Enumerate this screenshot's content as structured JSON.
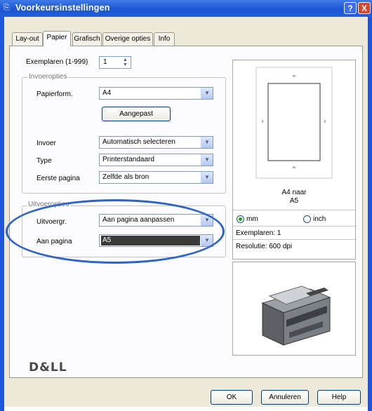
{
  "window": {
    "title": "Voorkeursinstellingen",
    "help_button": "?",
    "close_button": "X"
  },
  "tabs": [
    {
      "label": "Lay-out"
    },
    {
      "label": "Papier"
    },
    {
      "label": "Grafisch"
    },
    {
      "label": "Overige opties"
    },
    {
      "label": "Info"
    }
  ],
  "copies": {
    "label": "Exemplaren (1-999)",
    "value": "1"
  },
  "input_options": {
    "title": "Invoeropties",
    "paper_size_label": "Papierform.",
    "paper_size_value": "A4",
    "custom_button": "Aangepast",
    "source_label": "Invoer",
    "source_value": "Automatisch selecteren",
    "type_label": "Type",
    "type_value": "Printerstandaard",
    "first_page_label": "Eerste pagina",
    "first_page_value": "Zelfde als bron"
  },
  "output_options": {
    "title": "Uitvoeropties",
    "output_type_label": "Uitvoergr.",
    "output_type_value": "Aan pagina aanpassen",
    "fit_to_page_label": "Aan pagina",
    "fit_to_page_value": "A5"
  },
  "preview": {
    "caption_line1": "A4 naar",
    "caption_line2": "A5",
    "unit_mm": "mm",
    "unit_inch": "inch",
    "selected_unit": "mm",
    "copies_info": "Exemplaren: 1",
    "resolution_info": "Resolutie: 600 dpi"
  },
  "brand": "D&LL",
  "footer": {
    "ok": "OK",
    "cancel": "Annuleren",
    "help": "Help"
  },
  "colors": {
    "title_bar": "#1b54d4",
    "highlight_ellipse": "#2c63c4",
    "dialog_bg": "#ece9d8"
  }
}
